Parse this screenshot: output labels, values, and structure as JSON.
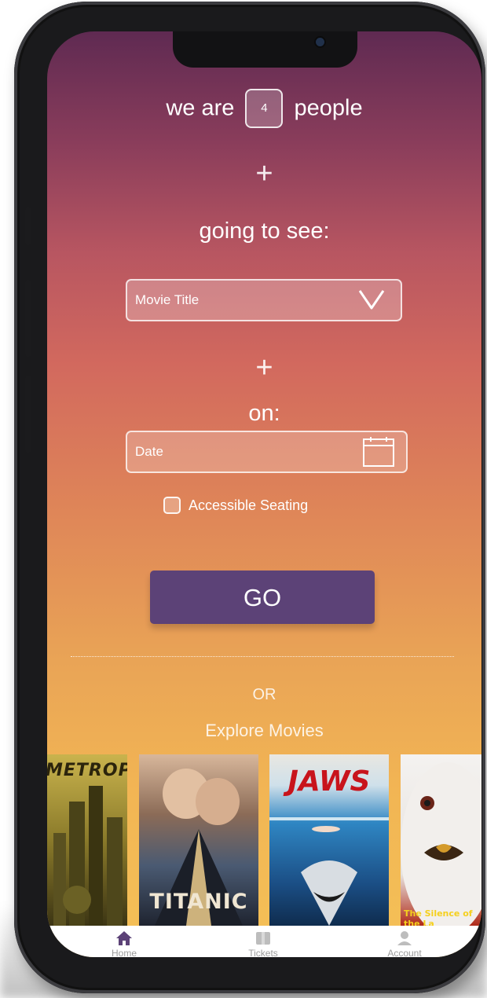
{
  "form": {
    "people_prefix": "we are",
    "people_count": "4",
    "people_suffix": "people",
    "plus_symbol": "+",
    "going_label": "going to see:",
    "movie_select_placeholder": "Movie Title",
    "on_label": "on:",
    "date_placeholder": "Date",
    "accessible_label": "Accessible Seating",
    "accessible_checked": false,
    "go_label": "GO"
  },
  "explore": {
    "or_text": "OR",
    "title": "Explore Movies",
    "posters": [
      {
        "title": "METROPOLIS"
      },
      {
        "title": "TITANIC"
      },
      {
        "title": "JAWS"
      },
      {
        "title": "The Silence of the La"
      }
    ]
  },
  "tabbar": {
    "items": [
      {
        "label": "Home",
        "icon": "home-icon",
        "active": true
      },
      {
        "label": "Tickets",
        "icon": "ticket-icon",
        "active": false
      },
      {
        "label": "Account",
        "icon": "account-icon",
        "active": false
      }
    ]
  },
  "colors": {
    "go_button": "#5c4277",
    "active_tab_icon": "#5c4277",
    "inactive_tab_icon": "#bdbdbd",
    "gradient_top": "#5f2a52",
    "gradient_bottom": "#f4c157"
  }
}
